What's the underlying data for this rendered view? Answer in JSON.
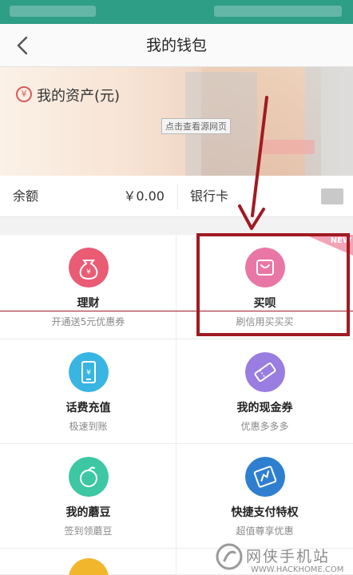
{
  "header": {
    "title": "我的钱包",
    "back_icon": "back-chevron-icon"
  },
  "banner": {
    "asset_label": "我的资产(元)",
    "asset_icon": "yen-circle-icon",
    "view_source": "点击查看源网页"
  },
  "balance": {
    "label": "余额",
    "value": "￥0.00",
    "bank_label": "银行卡"
  },
  "features": [
    {
      "name": "理财",
      "sub": "开通送5元优惠券",
      "icon": "money-bag-icon",
      "color": "#ea5b74"
    },
    {
      "name": "买呗",
      "sub": "刷信用买买买",
      "icon": "shopping-bag-icon",
      "color": "#e877a6",
      "badge": "NEW"
    },
    {
      "name": "话费充值",
      "sub": "极速到账",
      "icon": "phone-recharge-icon",
      "color": "#38b5e3"
    },
    {
      "name": "我的现金券",
      "sub": "优惠多多多",
      "icon": "coupon-icon",
      "color": "#9a7de0"
    },
    {
      "name": "我的蘑豆",
      "sub": "签到领蘑豆",
      "icon": "bean-icon",
      "color": "#3dc7a3"
    },
    {
      "name": "快捷支付特权",
      "sub": "超值尊享优惠",
      "icon": "card-privilege-icon",
      "color": "#2f7fd0"
    }
  ],
  "watermark": {
    "text": "网侠手机站",
    "url": "WWW.HACKHOME.COM"
  }
}
